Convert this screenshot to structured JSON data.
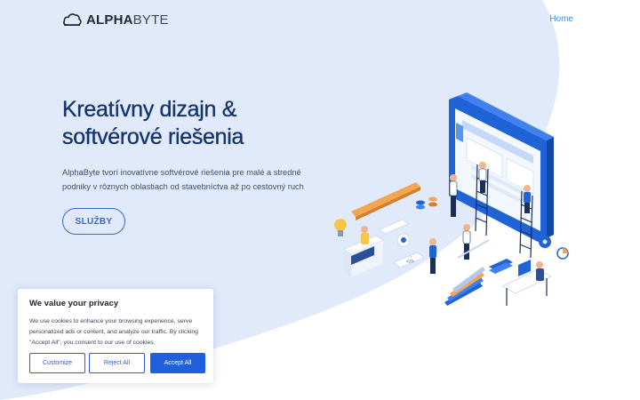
{
  "brand": {
    "name_bold": "ALPHA",
    "name_light": "BYTE",
    "logo_icon": "cloud-logo-icon"
  },
  "nav": {
    "home": "Home"
  },
  "hero": {
    "title_line1": "Kreatívny dizajn &",
    "title_line2": "softvérové riešenia",
    "description": "AlphaByte tvorí inovatívne softvérové riešenia pre malé a stredné podniky v rôznych oblastiach od stavebníctva až po cestovný ruch",
    "button": "SLUŽBY"
  },
  "cookie_banner": {
    "title": "We value your privacy",
    "text": "We use cookies to enhance your browsing experience, serve personalized ads or content, and analyze our traffic. By clicking \"Accept All\", you consent to our use of cookies.",
    "customize": "Customize",
    "reject": "Reject All",
    "accept": "Accept All"
  },
  "colors": {
    "background_blob": "#e1eafb",
    "title": "#16346d",
    "accent": "#2160dc",
    "link": "#3a8fd8"
  }
}
